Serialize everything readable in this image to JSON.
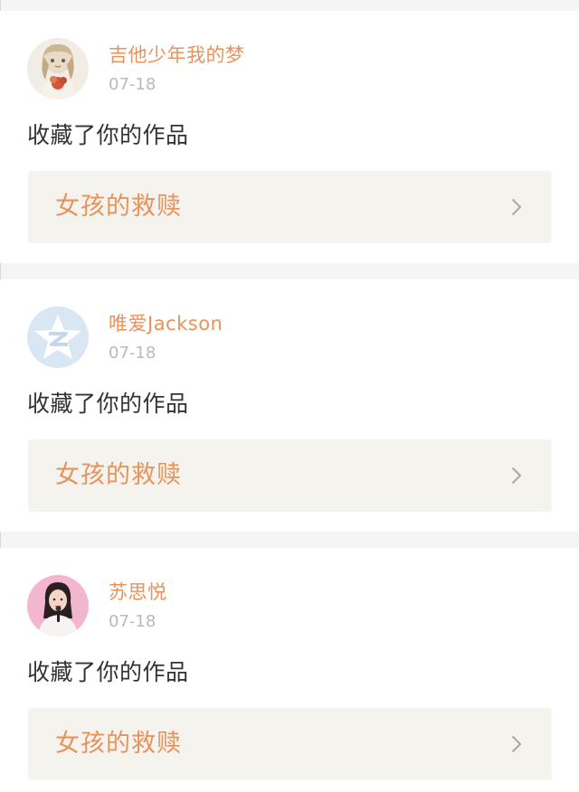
{
  "notifications": [
    {
      "username": "吉他少年我的梦",
      "date": "07-18",
      "action": "收藏了你的作品",
      "work_title": "女孩的救赎",
      "avatar_icon": "avatar-illustrated-girl"
    },
    {
      "username": "唯爱Jackson",
      "date": "07-18",
      "action": "收藏了你的作品",
      "work_title": "女孩的救赎",
      "avatar_icon": "avatar-qzone-star-default"
    },
    {
      "username": "苏思悦",
      "date": "07-18",
      "action": "收藏了你的作品",
      "work_title": "女孩的救赎",
      "avatar_icon": "avatar-photo-girl-pink"
    }
  ],
  "colors": {
    "accent": "#e8925c",
    "page_bg": "#f6f4f4",
    "card_bg": "#ffffff",
    "link_box_bg": "#f4f3ed",
    "date_text": "#b9b9b9",
    "body_text": "#333333"
  }
}
